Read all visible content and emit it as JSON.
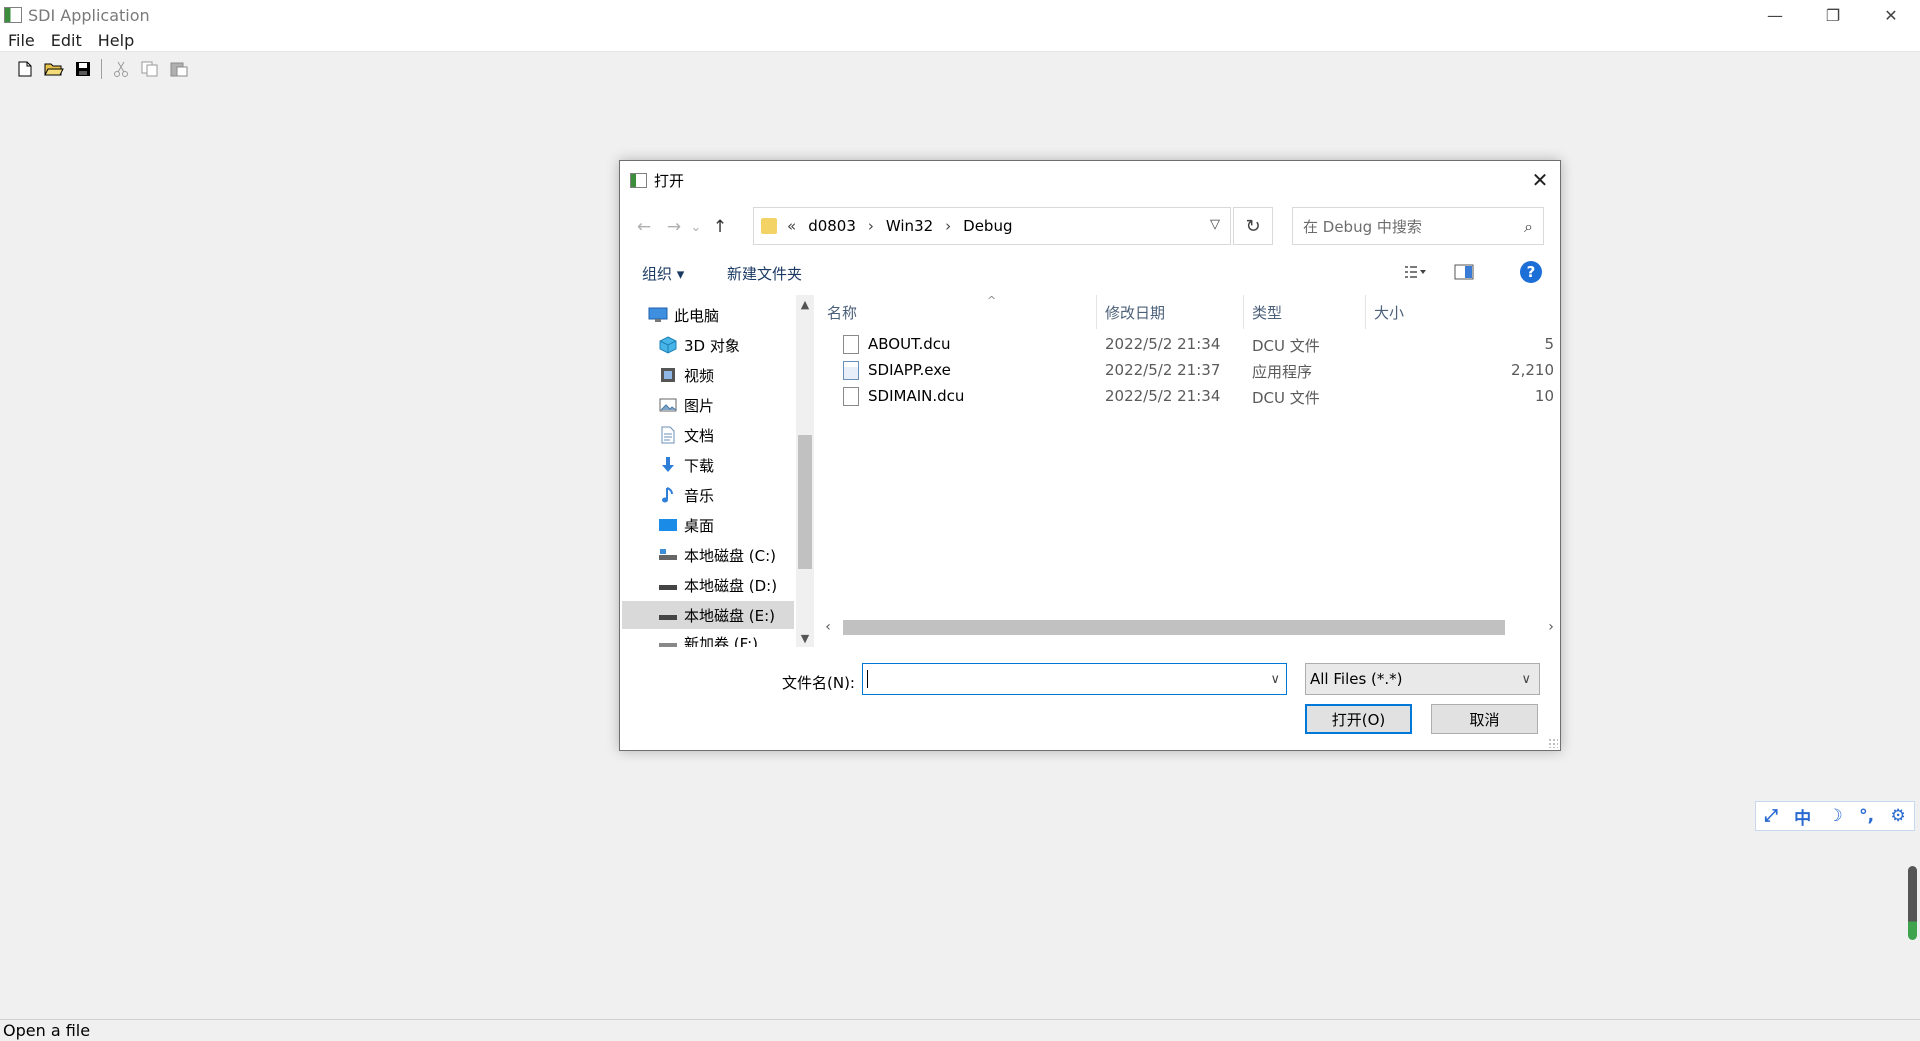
{
  "app": {
    "title": "SDI Application"
  },
  "window_controls": {
    "minimize": "—",
    "maximize": "❐",
    "close": "✕"
  },
  "menu": {
    "file": "File",
    "edit": "Edit",
    "help": "Help"
  },
  "status": {
    "text": "Open a file"
  },
  "dialog": {
    "title": "打开",
    "close": "✕",
    "nav": {
      "back": "←",
      "forward": "→",
      "recent": "⌄",
      "up": "↑"
    },
    "address": {
      "prefix": "«",
      "segments": [
        "d0803",
        "Win32",
        "Debug"
      ],
      "separator": "›"
    },
    "search_placeholder": "在 Debug 中搜索",
    "commands": {
      "organize": "组织 ▾",
      "new_folder": "新建文件夹"
    },
    "tree": [
      {
        "label": "此电脑",
        "icon": "pc-icon"
      },
      {
        "label": "3D 对象",
        "icon": "cube-icon"
      },
      {
        "label": "视频",
        "icon": "video-icon"
      },
      {
        "label": "图片",
        "icon": "picture-icon"
      },
      {
        "label": "文档",
        "icon": "document-icon"
      },
      {
        "label": "下载",
        "icon": "download-icon"
      },
      {
        "label": "音乐",
        "icon": "music-icon"
      },
      {
        "label": "桌面",
        "icon": "desktop-icon"
      },
      {
        "label": "本地磁盘 (C:)",
        "icon": "drive-icon"
      },
      {
        "label": "本地磁盘 (D:)",
        "icon": "drive-icon"
      },
      {
        "label": "本地磁盘 (E:)",
        "icon": "drive-icon",
        "selected": true
      },
      {
        "label": "新加卷 (F:)",
        "icon": "drive-icon"
      }
    ],
    "columns": {
      "name": "名称",
      "modified": "修改日期",
      "type": "类型",
      "size": "大小"
    },
    "files": [
      {
        "name": "ABOUT.dcu",
        "modified": "2022/5/2 21:34",
        "type": "DCU 文件",
        "size": "5",
        "icon": "file-icon"
      },
      {
        "name": "SDIAPP.exe",
        "modified": "2022/5/2 21:37",
        "type": "应用程序",
        "size": "2,210",
        "icon": "exe-icon"
      },
      {
        "name": "SDIMAIN.dcu",
        "modified": "2022/5/2 21:34",
        "type": "DCU 文件",
        "size": "10",
        "icon": "file-icon"
      }
    ],
    "filename_label": "文件名(N):",
    "filename_value": "",
    "filetype": "All Files (*.*)",
    "open_button": "打开(O)",
    "cancel_button": "取消"
  },
  "ime": {
    "lang": "中",
    "moon": "☽",
    "punct": "°,",
    "gear": "⚙"
  },
  "colors": {
    "accent": "#0078d7",
    "help_blue": "#1d6fd8",
    "ime_blue": "#2a6ad0"
  }
}
